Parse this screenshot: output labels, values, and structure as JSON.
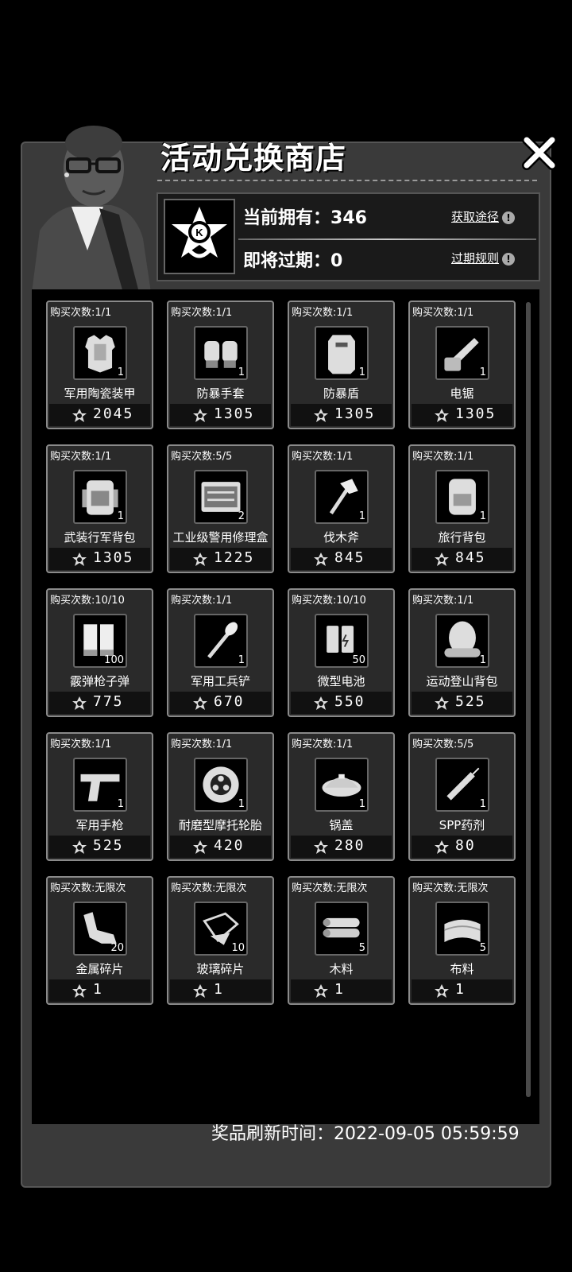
{
  "header": {
    "title": "活动兑换商店",
    "owned_label": "当前拥有：",
    "owned_value": "346",
    "expiring_label": "即将过期：",
    "expiring_value": "0",
    "obtain_link": "获取途径",
    "expire_rule_link": "过期规则"
  },
  "items": [
    {
      "limit": "购买次数:1/1",
      "name": "军用陶瓷装甲",
      "qty": "1",
      "price": "2045",
      "icon": "armor-vest-icon"
    },
    {
      "limit": "购买次数:1/1",
      "name": "防暴手套",
      "qty": "1",
      "price": "1305",
      "icon": "gloves-icon"
    },
    {
      "limit": "购买次数:1/1",
      "name": "防暴盾",
      "qty": "1",
      "price": "1305",
      "icon": "riot-shield-icon"
    },
    {
      "limit": "购买次数:1/1",
      "name": "电锯",
      "qty": "1",
      "price": "1305",
      "icon": "chainsaw-icon"
    },
    {
      "limit": "购买次数:1/1",
      "name": "武装行军背包",
      "qty": "1",
      "price": "1305",
      "icon": "military-backpack-icon"
    },
    {
      "limit": "购买次数:5/5",
      "name": "工业级警用修理盒",
      "qty": "2",
      "price": "1225",
      "icon": "repair-kit-icon"
    },
    {
      "limit": "购买次数:1/1",
      "name": "伐木斧",
      "qty": "1",
      "price": "845",
      "icon": "axe-icon"
    },
    {
      "limit": "购买次数:1/1",
      "name": "旅行背包",
      "qty": "1",
      "price": "845",
      "icon": "travel-backpack-icon"
    },
    {
      "limit": "购买次数:10/10",
      "name": "霰弹枪子弹",
      "qty": "100",
      "price": "775",
      "icon": "shotgun-shell-icon"
    },
    {
      "limit": "购买次数:1/1",
      "name": "军用工兵铲",
      "qty": "1",
      "price": "670",
      "icon": "shovel-icon"
    },
    {
      "limit": "购买次数:10/10",
      "name": "微型电池",
      "qty": "50",
      "price": "550",
      "icon": "battery-icon"
    },
    {
      "limit": "购买次数:1/1",
      "name": "运动登山背包",
      "qty": "1",
      "price": "525",
      "icon": "hiking-backpack-icon"
    },
    {
      "limit": "购买次数:1/1",
      "name": "军用手枪",
      "qty": "1",
      "price": "525",
      "icon": "pistol-icon"
    },
    {
      "limit": "购买次数:1/1",
      "name": "耐磨型摩托轮胎",
      "qty": "1",
      "price": "420",
      "icon": "tire-icon"
    },
    {
      "limit": "购买次数:1/1",
      "name": "锅盖",
      "qty": "1",
      "price": "280",
      "icon": "pot-lid-icon"
    },
    {
      "limit": "购买次数:5/5",
      "name": "SPP药剂",
      "qty": "1",
      "price": "80",
      "icon": "syringe-icon"
    },
    {
      "limit": "购买次数:无限次",
      "name": "金属碎片",
      "qty": "20",
      "price": "1",
      "icon": "metal-scrap-icon"
    },
    {
      "limit": "购买次数:无限次",
      "name": "玻璃碎片",
      "qty": "10",
      "price": "1",
      "icon": "glass-shard-icon"
    },
    {
      "limit": "购买次数:无限次",
      "name": "木料",
      "qty": "5",
      "price": "1",
      "icon": "wood-icon"
    },
    {
      "limit": "购买次数:无限次",
      "name": "布料",
      "qty": "5",
      "price": "1",
      "icon": "cloth-icon"
    }
  ],
  "footer": {
    "refresh_label": "奖品刷新时间：",
    "refresh_time": "2022-09-05 05:59:59"
  }
}
